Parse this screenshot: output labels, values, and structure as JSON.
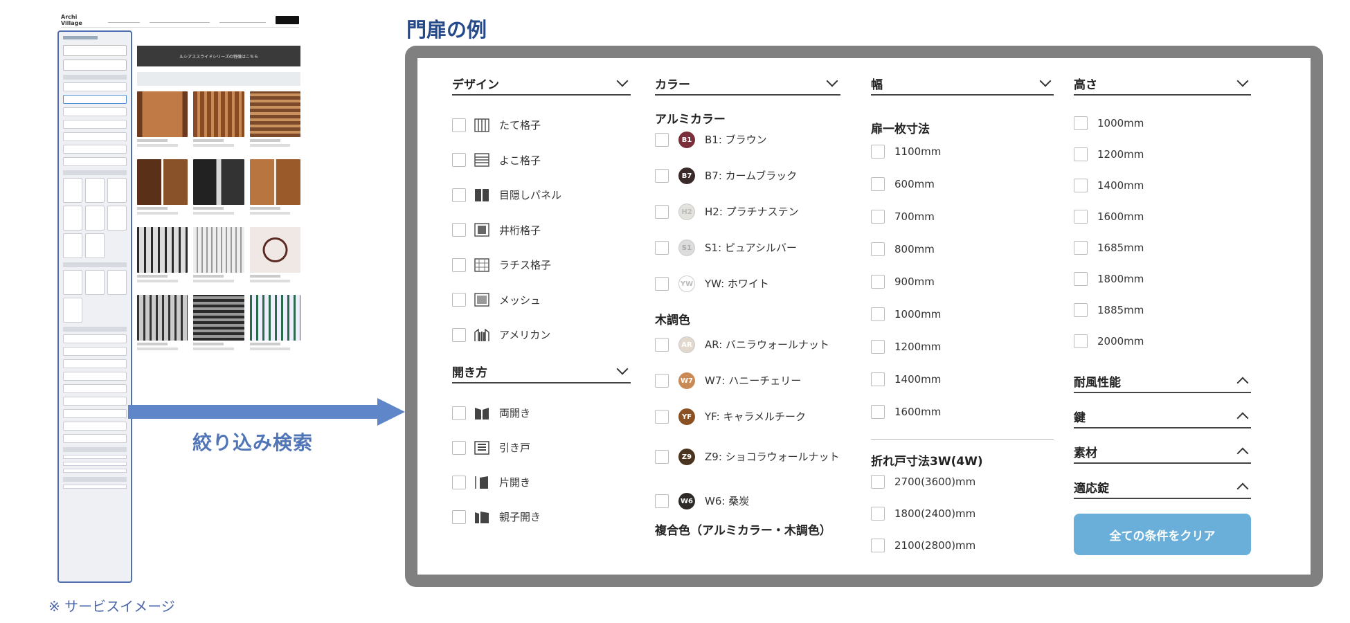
{
  "thumbnail": {
    "logo": "Archi Village",
    "banner": "ルシアススライドシリーズの特徴はこちら"
  },
  "callout": {
    "label": "絞り込み検索",
    "note": "※ サービスイメージ"
  },
  "title": "門扉の例",
  "colors": {
    "title": "#25498a",
    "frame": "#808080",
    "arrow": "#5f86c9",
    "button": "#6aafd9"
  },
  "design": {
    "header": "デザイン",
    "items": [
      {
        "label": "たて格子",
        "icon": "vertical-lattice-icon"
      },
      {
        "label": "よこ格子",
        "icon": "horizontal-lattice-icon"
      },
      {
        "label": "目隠しパネル",
        "icon": "screen-panel-icon"
      },
      {
        "label": "井桁格子",
        "icon": "grid-lattice-icon"
      },
      {
        "label": "ラチス格子",
        "icon": "lattice-icon"
      },
      {
        "label": "メッシュ",
        "icon": "mesh-icon"
      },
      {
        "label": "アメリカン",
        "icon": "american-icon"
      }
    ]
  },
  "opening": {
    "header": "開き方",
    "items": [
      {
        "label": "両開き",
        "icon": "double-door-icon"
      },
      {
        "label": "引き戸",
        "icon": "sliding-door-icon"
      },
      {
        "label": "片開き",
        "icon": "single-door-icon"
      },
      {
        "label": "親子開き",
        "icon": "parent-child-door-icon"
      }
    ]
  },
  "color": {
    "header": "カラー",
    "aluminum_header": "アルミカラー",
    "aluminum": [
      {
        "code": "B1",
        "label": "B1: ブラウン",
        "bg": "#7a2f3a",
        "fg": "#ffffff"
      },
      {
        "code": "B7",
        "label": "B7: カームブラック",
        "bg": "#3a2a2a",
        "fg": "#ffffff"
      },
      {
        "code": "H2",
        "label": "H2: プラチナステン",
        "bg": "#e4e2dc",
        "fg": "#bbbbbb"
      },
      {
        "code": "S1",
        "label": "S1: ピュアシルバー",
        "bg": "#dcdcdc",
        "fg": "#aaaaaa"
      },
      {
        "code": "YW",
        "label": "YW: ホワイト",
        "bg": "#ffffff",
        "fg": "#bbbbbb"
      }
    ],
    "wood_header": "木調色",
    "wood": [
      {
        "code": "AR",
        "label": "AR: バニラウォールナット",
        "bg": "#e3d8cd",
        "fg": "#ffffff"
      },
      {
        "code": "W7",
        "label": "W7: ハニーチェリー",
        "bg": "#c98a55",
        "fg": "#ffffff"
      },
      {
        "code": "YF",
        "label": "YF: キャラメルチーク",
        "bg": "#8a5224",
        "fg": "#ffffff"
      },
      {
        "code": "Z9",
        "label": "Z9: ショコラウォールナット",
        "bg": "#4a3420",
        "fg": "#ffffff"
      },
      {
        "code": "W6",
        "label": "W6: 桑炭",
        "bg": "#2e2a28",
        "fg": "#ffffff"
      }
    ],
    "composite_header": "複合色（アルミカラー・木調色）"
  },
  "width": {
    "header": "幅",
    "door_header": "扉一枚寸法",
    "door_sizes": [
      "1100mm",
      "600mm",
      "700mm",
      "800mm",
      "900mm",
      "1000mm",
      "1200mm",
      "1400mm",
      "1600mm"
    ],
    "fold_header": "折れ戸寸法3W(4W)",
    "fold_sizes": [
      "2700(3600)mm",
      "1800(2400)mm",
      "2100(2800)mm"
    ]
  },
  "height": {
    "header": "高さ",
    "items": [
      "1000mm",
      "1200mm",
      "1400mm",
      "1600mm",
      "1685mm",
      "1800mm",
      "1885mm",
      "2000mm"
    ]
  },
  "collapsed": [
    {
      "label": "耐風性能"
    },
    {
      "label": "鍵"
    },
    {
      "label": "素材"
    },
    {
      "label": "適応錠"
    }
  ],
  "clear_button": "全ての条件をクリア"
}
